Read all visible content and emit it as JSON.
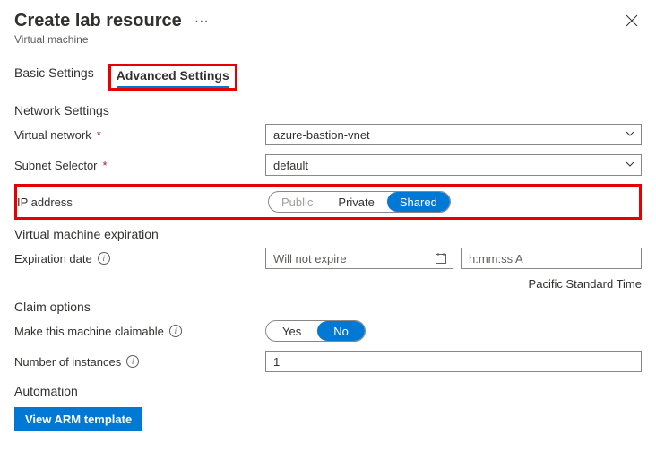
{
  "header": {
    "title": "Create lab resource",
    "subtitle": "Virtual machine"
  },
  "tabs": {
    "basic": "Basic Settings",
    "advanced": "Advanced Settings"
  },
  "network": {
    "section": "Network Settings",
    "vnet_label": "Virtual network",
    "vnet_value": "azure-bastion-vnet",
    "subnet_label": "Subnet Selector",
    "subnet_value": "default",
    "ip_label": "IP address",
    "ip_options": {
      "public": "Public",
      "private": "Private",
      "shared": "Shared"
    }
  },
  "expiration": {
    "section": "Virtual machine expiration",
    "date_label": "Expiration date",
    "date_placeholder": "Will not expire",
    "time_placeholder": "h:mm:ss A",
    "timezone": "Pacific Standard Time"
  },
  "claim": {
    "section": "Claim options",
    "claimable_label": "Make this machine claimable",
    "yes": "Yes",
    "no": "No",
    "instances_label": "Number of instances",
    "instances_value": "1"
  },
  "automation": {
    "section": "Automation",
    "view_arm": "View ARM template"
  }
}
